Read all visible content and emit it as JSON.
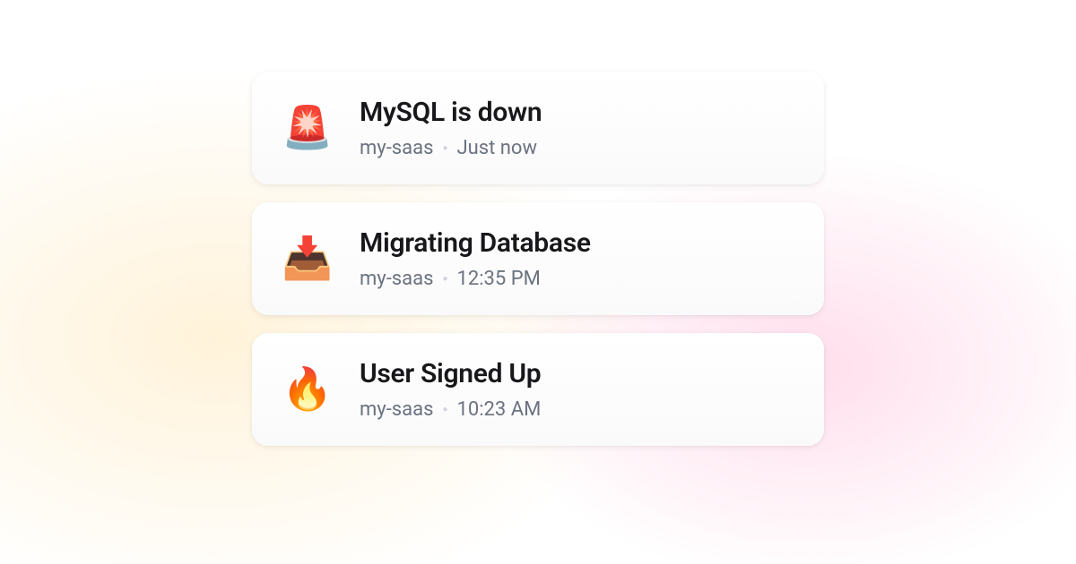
{
  "notifications": [
    {
      "icon": "🚨",
      "title": "MySQL is down",
      "project": "my-saas",
      "time": "Just now"
    },
    {
      "icon": "📥",
      "title": "Migrating Database",
      "project": "my-saas",
      "time": "12:35 PM"
    },
    {
      "icon": "🔥",
      "title": "User Signed Up",
      "project": "my-saas",
      "time": "10:23 AM"
    }
  ]
}
